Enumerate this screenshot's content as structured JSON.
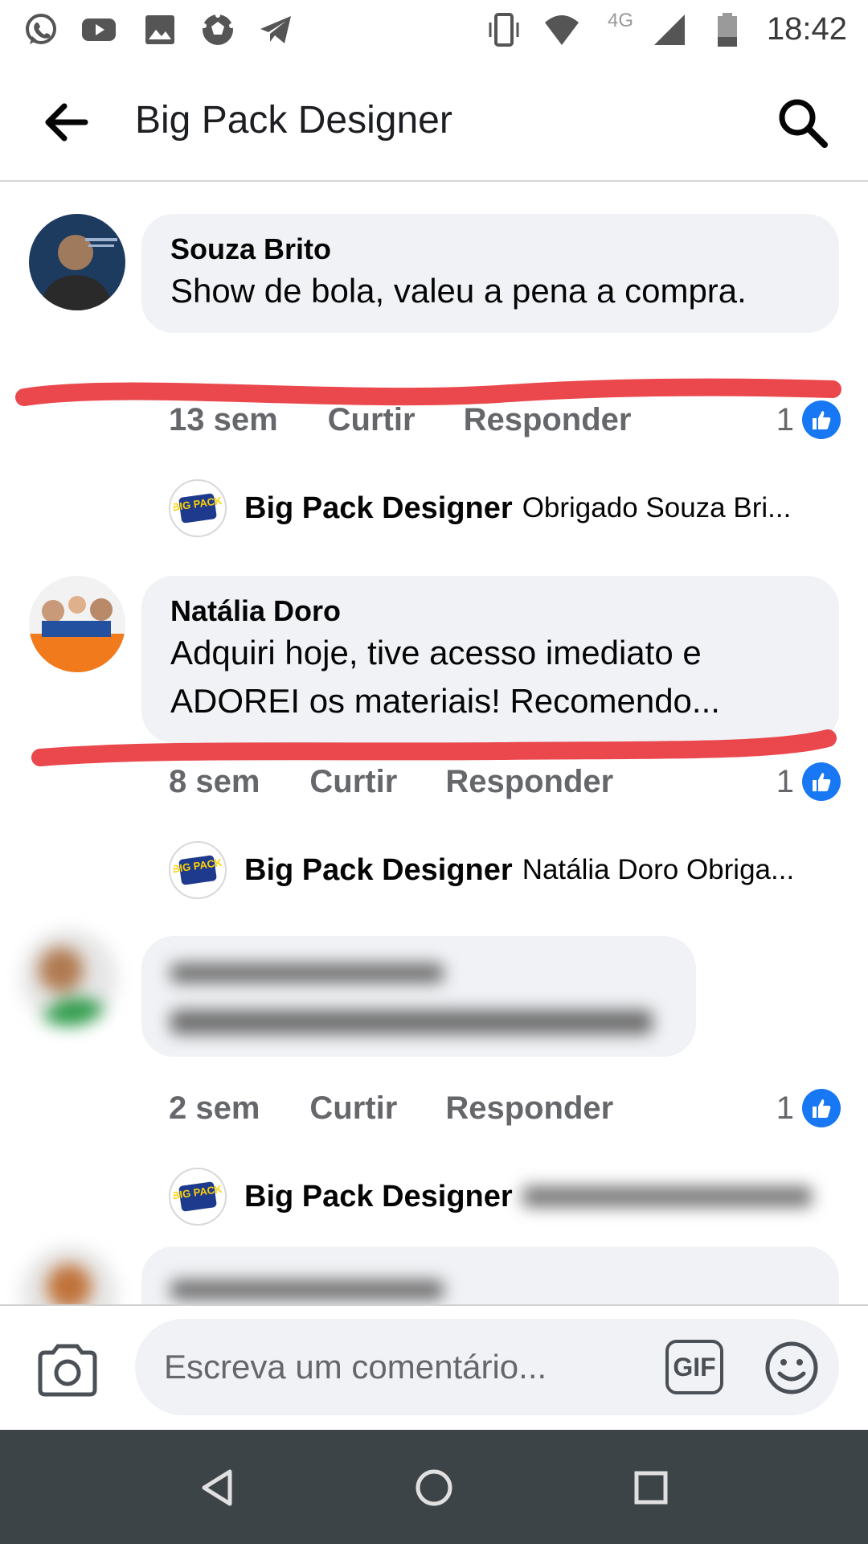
{
  "status_bar": {
    "time": "18:42",
    "network": "4G",
    "left_icons": [
      "whatsapp-icon",
      "youtube-icon",
      "gallery-icon",
      "soccer-ball-icon",
      "telegram-icon"
    ],
    "right_icons": [
      "vibrate-icon",
      "wifi-icon",
      "signal-icon",
      "battery-icon"
    ]
  },
  "header": {
    "title": "Big Pack Designer",
    "back_icon": "arrow-left-icon",
    "search_icon": "search-icon"
  },
  "comments": [
    {
      "author": "Souza Brito",
      "text": "Show de bola, valeu a pena a compra.",
      "time": "13 sem",
      "like_label": "Curtir",
      "reply_label": "Responder",
      "like_count": "1",
      "reply": {
        "author": "Big Pack Designer",
        "text": "Obrigado Souza Bri..."
      }
    },
    {
      "author": "Natália Doro",
      "text": "Adquiri hoje, tive acesso imediato e ADOREI os materiais! Recomendo...",
      "time": "8 sem",
      "like_label": "Curtir",
      "reply_label": "Responder",
      "like_count": "1",
      "reply": {
        "author": "Big Pack Designer",
        "text": "Natália Doro Obriga..."
      }
    },
    {
      "author": "",
      "text": "",
      "time": "2 sem",
      "like_label": "Curtir",
      "reply_label": "Responder",
      "like_count": "1",
      "reply": {
        "author": "Big Pack Designer",
        "text": ""
      }
    }
  ],
  "logo_text": "BIG PACK",
  "composer": {
    "placeholder": "Escreva um comentário...",
    "gif_label": "GIF",
    "camera_icon": "camera-icon",
    "emoji_icon": "smiley-icon"
  },
  "colors": {
    "like_blue": "#1877f2",
    "bubble_bg": "#f0f2f5",
    "meta_gray": "#65676b",
    "highlight_red": "#e8343a",
    "nav_bar": "#3d4447"
  }
}
